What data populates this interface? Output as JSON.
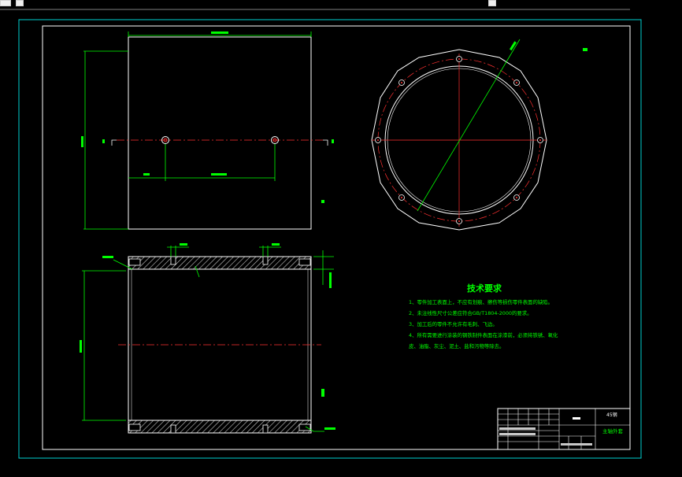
{
  "tech_requirements": {
    "title": "技术要求",
    "lines": [
      "1、零件加工表面上，不应有划痕、擦伤等损伤零件表面的缺陷。",
      "2、未注线性尺寸公差应符合GB/T1804-2000的要求。",
      "3、加工后的零件不允许有毛刺、飞边。",
      "4、所有需要进行涂装的钢铁制件表面在涂漆前，必须将铁锈、氧化",
      "皮、油脂、灰尘、泥土、盐和污物等除去。"
    ]
  },
  "title_block": {
    "part_name": "主轴外套",
    "material": "45钢"
  },
  "colors": {
    "background": "#000000",
    "outline": "#ffffff",
    "dimension": "#00ff00",
    "centerline": "#ff3030",
    "hatch": "#c8c8c8",
    "text": "#00ff00",
    "frame_outer": "#00d0d0"
  }
}
